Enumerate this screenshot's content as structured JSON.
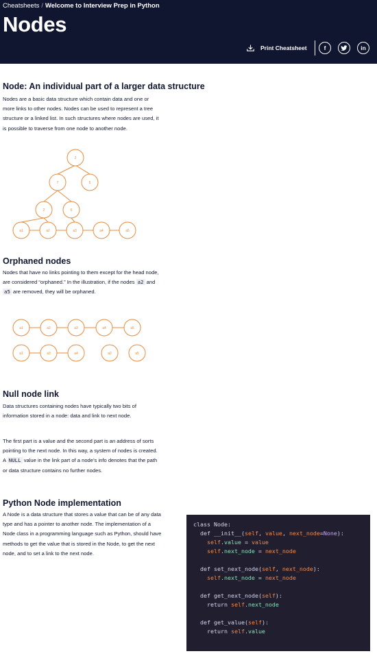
{
  "header": {
    "breadcrumb_root": "Cheatsheets",
    "breadcrumb_separator": "/",
    "breadcrumb_current": "Welcome to Interview Prep in Python",
    "title": "Nodes",
    "print_label": "Print Cheatsheet",
    "social": [
      {
        "name": "facebook",
        "glyph": "f"
      },
      {
        "name": "twitter",
        "glyph": "t"
      },
      {
        "name": "linkedin",
        "glyph": "in"
      }
    ]
  },
  "sections": {
    "node": {
      "title": "Node: An individual part of a larger data structure",
      "body": "Nodes are a basic data structure which contain data and one or more links to other nodes. Nodes can be used to represent a tree structure or a linked list. In such structures where nodes are used, it is possible to traverse from one node to another node."
    },
    "orphaned": {
      "title": "Orphaned nodes",
      "body_1": "Nodes that have no links pointing to them except for the head node, are considered “orphaned.” In the illustration, if the nodes ",
      "code_1": "a2",
      "body_2": " and ",
      "code_2": "a5",
      "body_3": " are removed, they will be orphaned."
    },
    "null_link": {
      "title": "Null node link",
      "body": "Data structures containing nodes have typically two bits of information stored in a node: data and link to next node.",
      "body2_1": "The first part is a value and the second part is an address of sorts pointing to the next node. In this way, a system of nodes is created. A ",
      "body2_code": "NULL",
      "body2_2": " value in the link part of a node’s info denotes that the path or data structure contains no further nodes."
    },
    "python": {
      "title": "Python Node implementation",
      "body": "A Node is a data structure that stores a value that can be of any data type and has a pointer to another node. The implementation of a Node class in a programming language such as Python, should have methods to get the value that is stored in the Node, to get the next node, and to set a link to the next node."
    }
  },
  "diagrams": {
    "tree": {
      "nodes": [
        "2",
        "7",
        "5",
        "2",
        "6",
        "a1",
        "a2",
        "a3",
        "a4",
        "a5"
      ]
    },
    "orphan_top": [
      "a1",
      "a2",
      "a3",
      "a4",
      "a5"
    ],
    "orphan_bottom": [
      "a1",
      "a3",
      "a4",
      "a2",
      "a5"
    ]
  },
  "code": {
    "language": "python",
    "lines": [
      "class Node:",
      "  def __init__(self, value, next_node=None):",
      "    self.value = value",
      "    self.next_node = next_node",
      "",
      "  def set_next_node(self, next_node):",
      "    self.next_node = next_node",
      "",
      "  def get_next_node(self):",
      "    return self.next_node",
      "",
      "  def get_value(self):",
      "    return self.value"
    ]
  },
  "colors": {
    "header_bg": "#10162f",
    "diagram_accent": "#e78b3c",
    "code_bg": "#211e2f"
  },
  "icons": {
    "print": "download-icon",
    "facebook": "facebook-icon",
    "twitter": "twitter-icon",
    "linkedin": "linkedin-icon"
  }
}
